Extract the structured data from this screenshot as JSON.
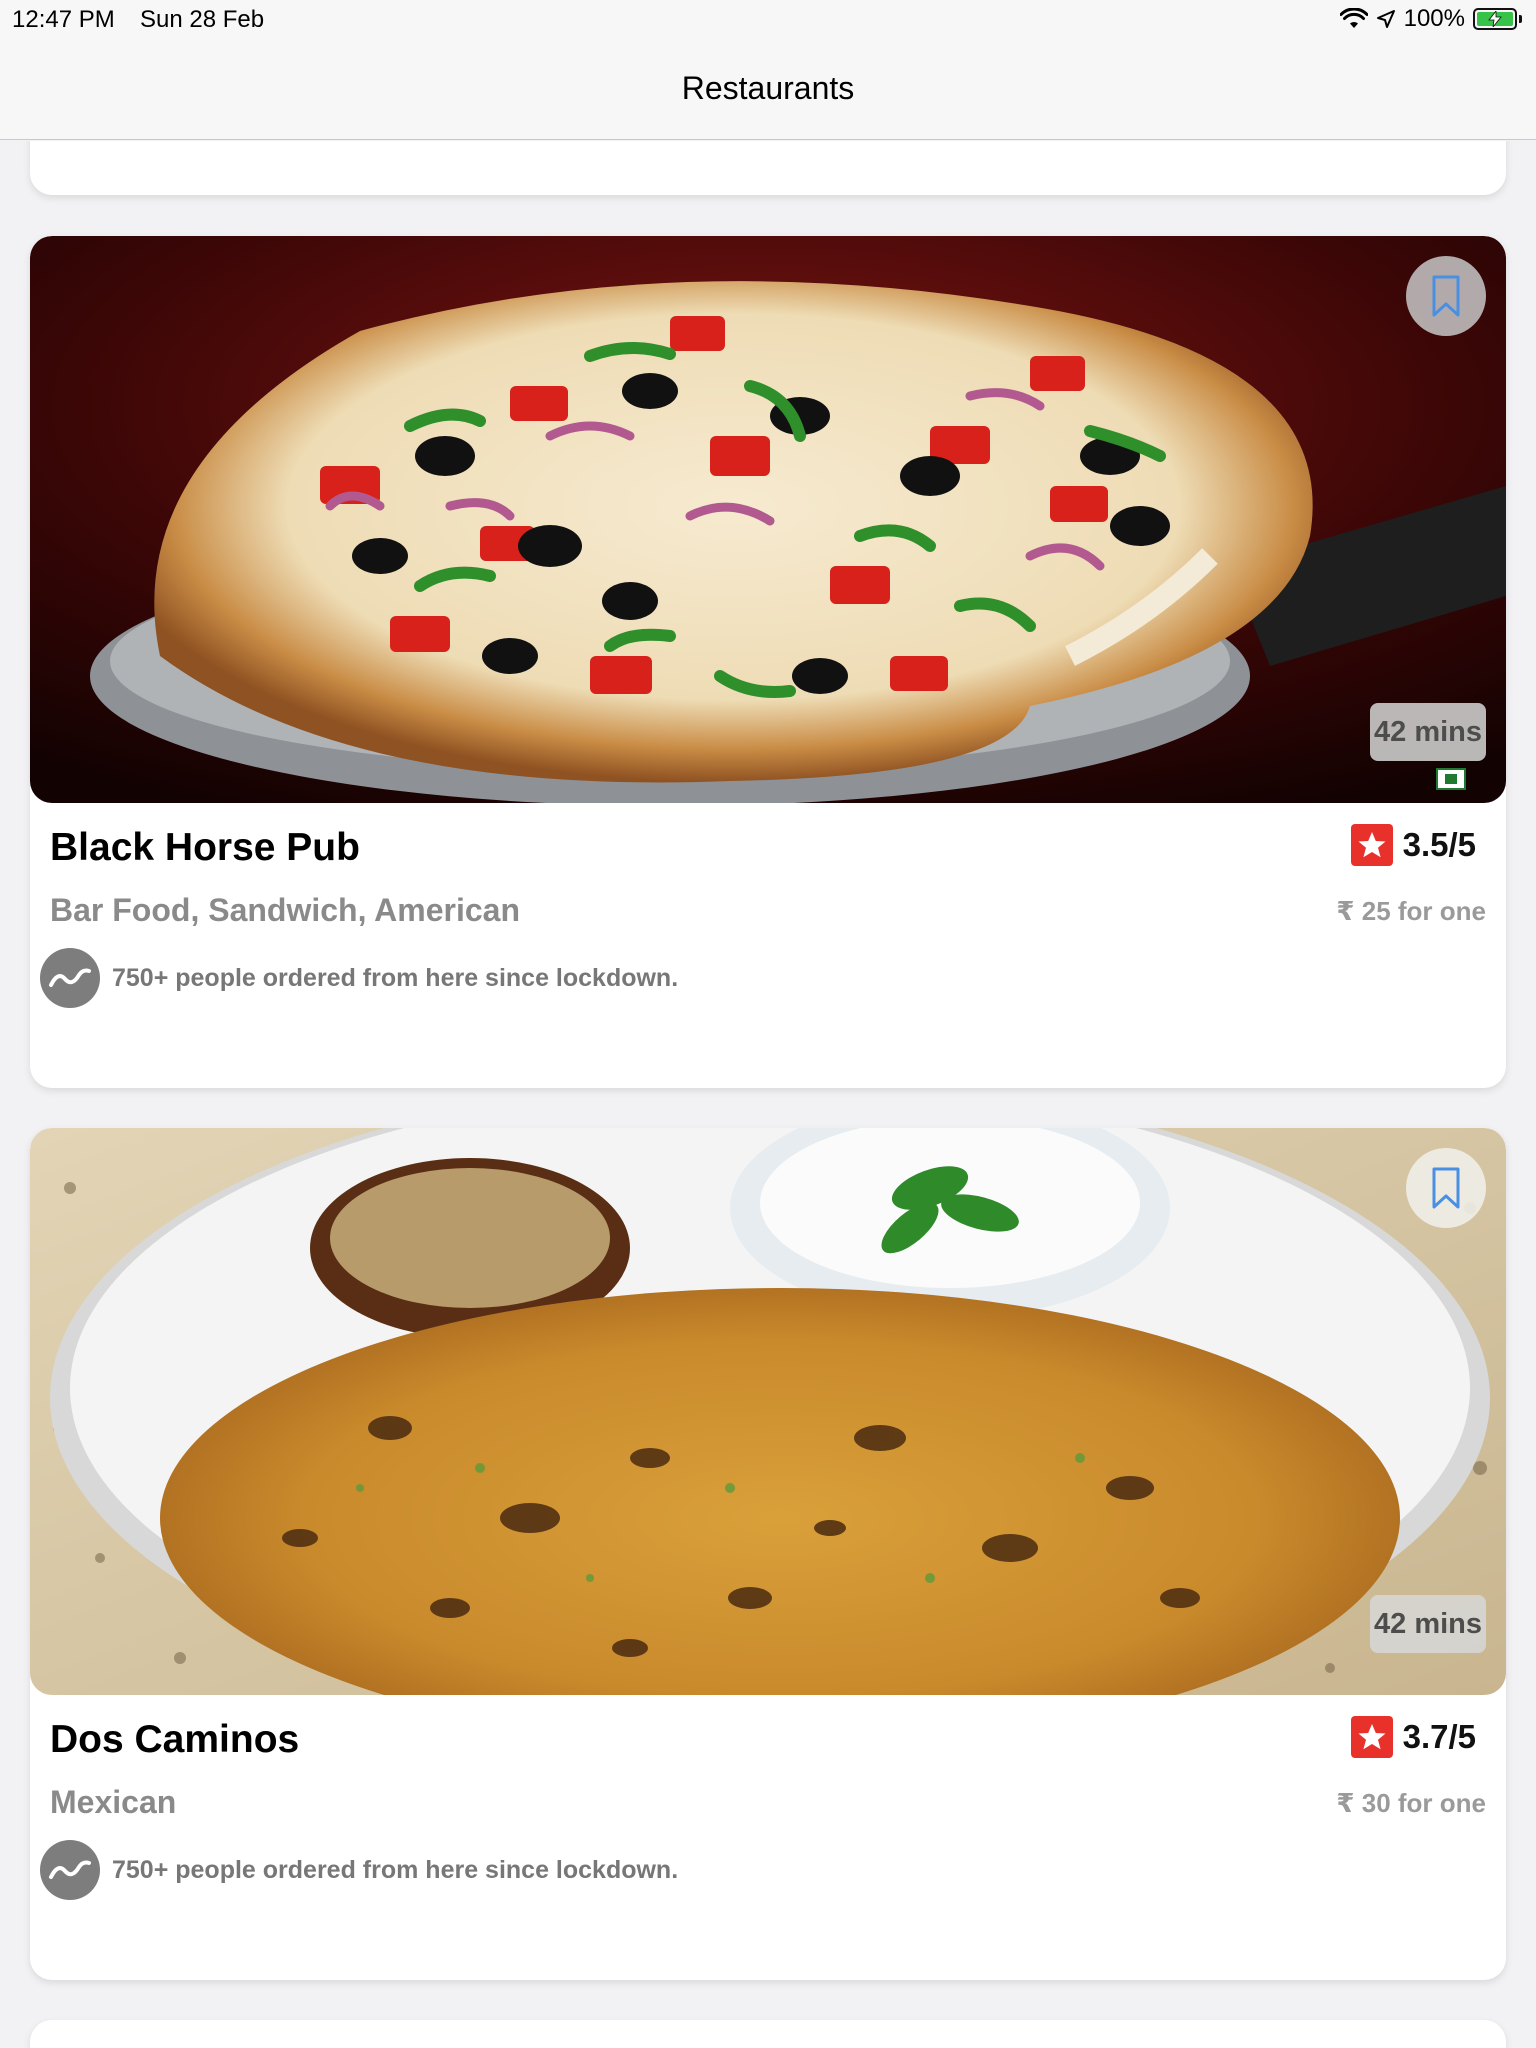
{
  "status_bar": {
    "time": "12:47 PM",
    "date": "Sun 28 Feb",
    "battery": "100%",
    "icons": [
      "wifi-icon",
      "location-arrow-icon",
      "battery-charging-icon"
    ]
  },
  "nav": {
    "title": "Restaurants"
  },
  "restaurants": [
    {
      "name": "Black Horse Pub",
      "cuisine": "Bar Food, Sandwich, American",
      "rating": "3.5/5",
      "price": "₹ 25 for one",
      "eta": "42 mins",
      "orders_note": "750+ people ordered from here since lockdown.",
      "image": "pizza"
    },
    {
      "name": "Dos Caminos",
      "cuisine": "Mexican",
      "rating": "3.7/5",
      "price": "₹ 30 for one",
      "eta": "42 mins",
      "orders_note": "750+ people ordered from here since lockdown.",
      "image": "paratha-plate"
    }
  ],
  "colors": {
    "rating_badge": "#e8312a",
    "bookmark_icon": "#4a90e2",
    "battery_fill": "#37c24a"
  }
}
